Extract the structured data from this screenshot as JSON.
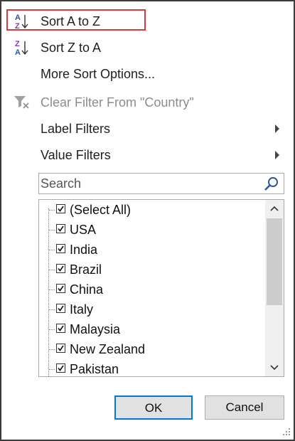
{
  "menu": {
    "sort_az": "Sort A to Z",
    "sort_za": "Sort Z to A",
    "more_sort": "More Sort Options...",
    "clear_filter": "Clear Filter From \"Country\"",
    "label_filters": "Label Filters",
    "value_filters": "Value Filters"
  },
  "search": {
    "placeholder": "Search",
    "value": ""
  },
  "list": {
    "items": [
      {
        "label": "(Select All)",
        "checked": true
      },
      {
        "label": "USA",
        "checked": true
      },
      {
        "label": "India",
        "checked": true
      },
      {
        "label": "Brazil",
        "checked": true
      },
      {
        "label": "China",
        "checked": true
      },
      {
        "label": "Italy",
        "checked": true
      },
      {
        "label": "Malaysia",
        "checked": true
      },
      {
        "label": "New Zealand",
        "checked": true
      },
      {
        "label": "Pakistan",
        "checked": true
      }
    ]
  },
  "buttons": {
    "ok": "OK",
    "cancel": "Cancel"
  },
  "colors": {
    "highlight": "#d9393d",
    "accent": "#0078d7",
    "az_icon_blue": "#2b579a",
    "az_icon_purple": "#7a3fa8"
  },
  "icons": {
    "sort_az": "sort-a-to-z-icon",
    "sort_za": "sort-z-to-a-icon",
    "clear_filter": "clear-filter-icon",
    "search": "search-icon",
    "submenu": "chevron-right-icon"
  }
}
